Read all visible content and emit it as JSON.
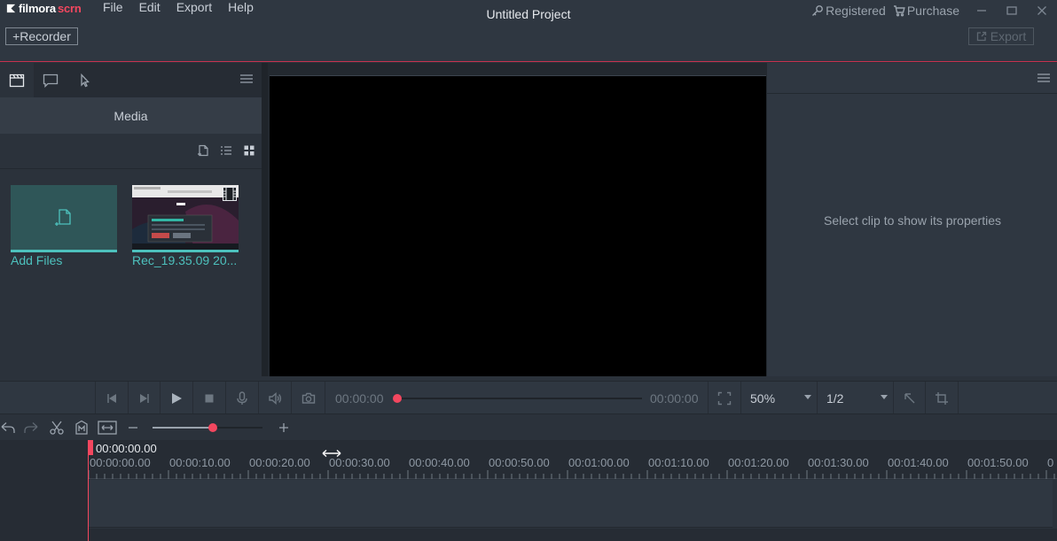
{
  "app": {
    "brand_main": "filmora",
    "brand_accent": "scrn",
    "project_title": "Untitled Project"
  },
  "menu": [
    "File",
    "Edit",
    "Export",
    "Help"
  ],
  "topright": {
    "registered": "Registered",
    "purchase": "Purchase"
  },
  "toolbar": {
    "recorder_label": "+Recorder",
    "export_label": "Export"
  },
  "media_panel": {
    "header": "Media",
    "items": [
      {
        "label": "Add Files"
      },
      {
        "label": "Rec_19.35.09 20..."
      }
    ]
  },
  "properties": {
    "empty_message": "Select clip to show its properties"
  },
  "playback": {
    "current_time": "00:00:00",
    "total_time": "00:00:00",
    "progress": 0,
    "zoom": "50%",
    "quality": "1/2"
  },
  "timeline": {
    "current_timecode": "00:00:00.00",
    "zoom_level": 0.55,
    "ruler_labels": [
      "00:00:00.00",
      "00:00:10.00",
      "00:00:20.00",
      "00:00:30.00",
      "00:00:40.00",
      "00:00:50.00",
      "00:01:00.00",
      "00:01:10.00",
      "00:01:20.00",
      "00:01:30.00",
      "00:01:40.00",
      "00:01:50.00",
      "0"
    ]
  },
  "colors": {
    "accent": "#f3475f",
    "teal": "#4dc1bd",
    "background": "#2b323b"
  }
}
